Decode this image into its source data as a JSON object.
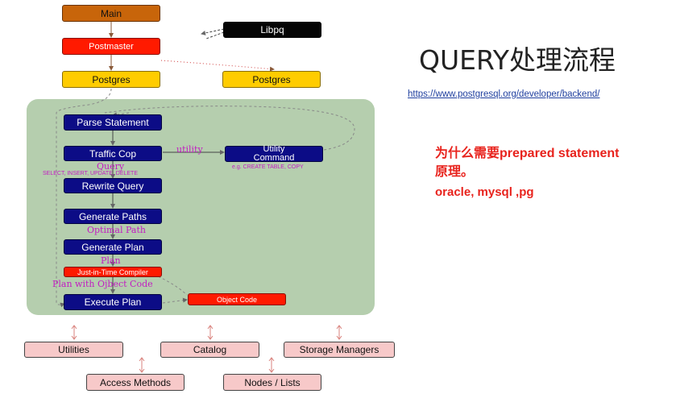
{
  "title": "QUERY处理流程",
  "link": "https://www.postgresql.org/developer/backend/",
  "question": {
    "line1": "为什么需要prepared statement",
    "line2": "原理。",
    "line3": "oracle, mysql ,pg"
  },
  "top_nodes": {
    "main": "Main",
    "postmaster": "Postmaster",
    "libpq": "Libpq",
    "postgres_left": "Postgres",
    "postgres_right": "Postgres"
  },
  "pipeline": {
    "parse": "Parse Statement",
    "traffic_cop": "Traffic Cop",
    "utility_command_line1": "Utility",
    "utility_command_line2": "Command",
    "rewrite": "Rewrite Query",
    "gen_paths": "Generate Paths",
    "gen_plan": "Generate Plan",
    "jit": "Just-in-Time Compiler",
    "execute": "Execute Plan",
    "object_code": "Object Code"
  },
  "edge_labels": {
    "utility": "utility",
    "query": "Query",
    "query_examples": "SELECT, INSERT, UPDATE, DELETE",
    "utility_examples": "e.g. CREATE TABLE, COPY",
    "optimal_path": "Optimal Path",
    "plan": "Plan",
    "plan_object_code": "Plan with Ojbect Code"
  },
  "bottom_nodes": {
    "utilities": "Utilities",
    "catalog": "Catalog",
    "storage_managers": "Storage Managers",
    "access_methods": "Access Methods",
    "nodes_lists": "Nodes / Lists"
  },
  "colors": {
    "navy": "#0c0c86",
    "panel": "#b5ceae",
    "magenta": "#c21cc2",
    "red": "#e8231d"
  }
}
